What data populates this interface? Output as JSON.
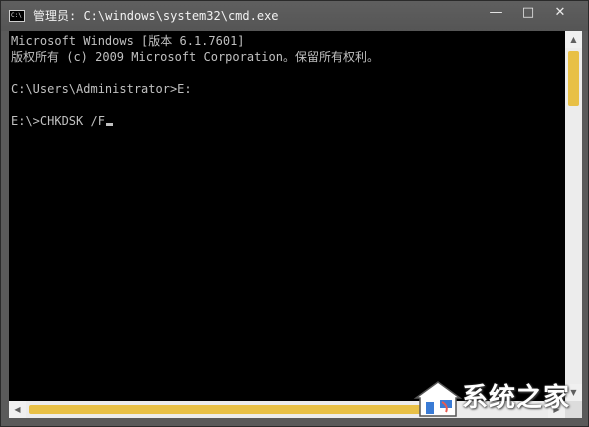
{
  "window": {
    "title": "管理员: C:\\windows\\system32\\cmd.exe",
    "icon": "console-app-icon",
    "icon_glyph": "C:\\",
    "controls": {
      "minimize": "—",
      "maximize": "□",
      "close": "✕"
    }
  },
  "console": {
    "lines": [
      "Microsoft Windows [版本 6.1.7601]",
      "版权所有 (c) 2009 Microsoft Corporation。保留所有权利。",
      "",
      "C:\\Users\\Administrator>E:",
      "",
      "E:\\>CHKDSK /F"
    ],
    "colors": {
      "background": "#000000",
      "text": "#c0c0c0"
    }
  },
  "scrollbars": {
    "thumb_color": "#e8c046",
    "up_glyph": "▲",
    "down_glyph": "▼",
    "left_glyph": "◀",
    "right_glyph": "▶"
  },
  "watermark": {
    "text": "系统之家"
  }
}
